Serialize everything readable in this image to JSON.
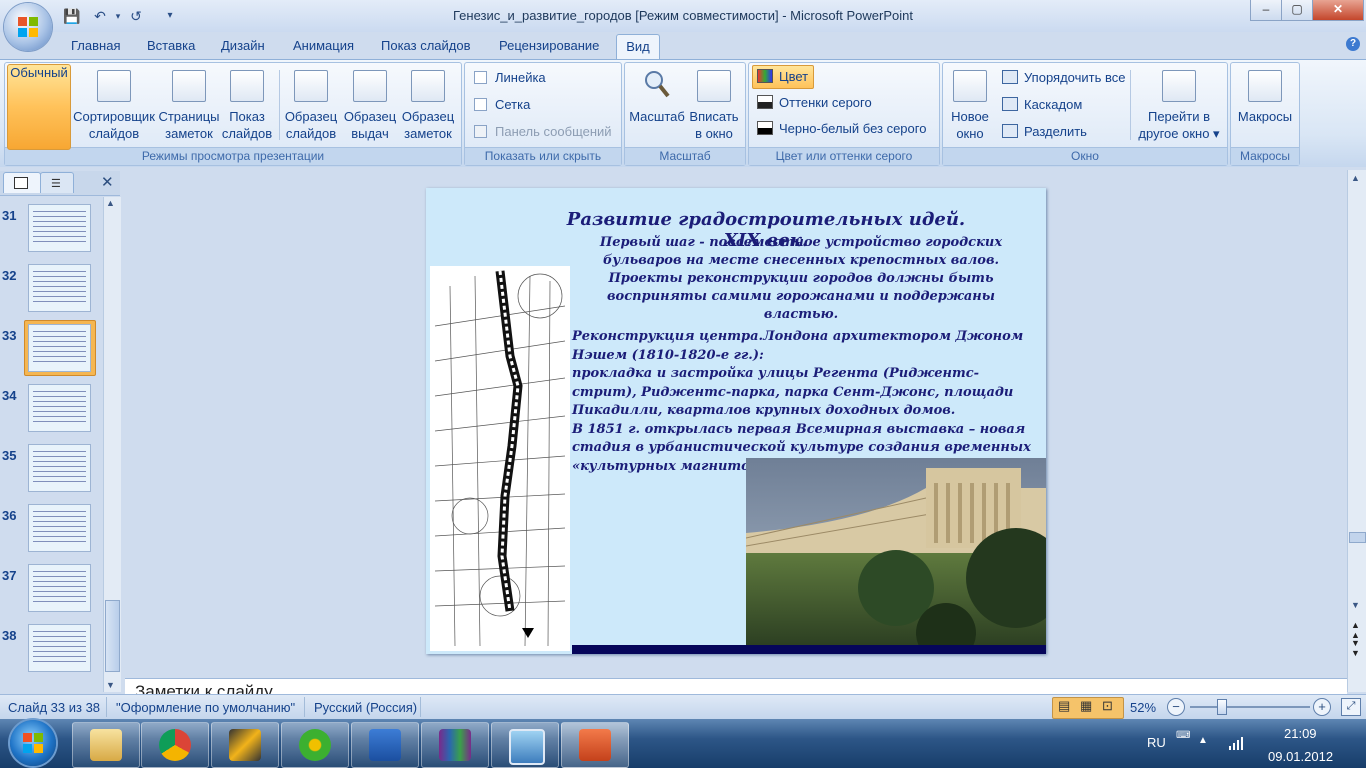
{
  "window": {
    "title": "Генезис_и_развитие_городов [Режим совместимости] - Microsoft PowerPoint",
    "min": "–",
    "max": "▢",
    "close": "✕"
  },
  "quick_access": {
    "save": "💾",
    "undo": "↶",
    "undo_arrow": "▾",
    "redo": "↺",
    "customize": "▾"
  },
  "tabs": [
    "Главная",
    "Вставка",
    "Дизайн",
    "Анимация",
    "Показ слайдов",
    "Рецензирование",
    "Вид"
  ],
  "active_tab": "Вид",
  "ribbon": {
    "views": {
      "label": "Режимы просмотра презентации",
      "normal": "Обычный",
      "sorter": [
        "Сортировщик",
        "слайдов"
      ],
      "notes": [
        "Страницы",
        "заметок"
      ],
      "show": [
        "Показ",
        "слайдов"
      ],
      "master_slide": [
        "Образец",
        "слайдов"
      ],
      "master_handout": [
        "Образец",
        "выдач"
      ],
      "master_notes": [
        "Образец",
        "заметок"
      ]
    },
    "show_hide": {
      "label": "Показать или скрыть",
      "ruler": "Линейка",
      "grid": "Сетка",
      "message_bar": "Панель сообщений"
    },
    "zoom": {
      "label": "Масштаб",
      "zoom": "Масштаб",
      "fit": [
        "Вписать",
        "в окно"
      ]
    },
    "color": {
      "label": "Цвет или оттенки серого",
      "color": "Цвет",
      "grayscale": "Оттенки серого",
      "bw": "Черно-белый без серого"
    },
    "window": {
      "label": "Окно",
      "new": [
        "Новое",
        "окно"
      ],
      "arrange": "Упорядочить все",
      "cascade": "Каскадом",
      "split": "Разделить",
      "switch": [
        "Перейти в",
        "другое окно ▾"
      ]
    },
    "macros": {
      "label": "Макросы",
      "macros": "Макросы"
    }
  },
  "slides_panel": {
    "close": "✕",
    "thumbnails": [
      "31",
      "32",
      "33",
      "34",
      "35",
      "36",
      "37",
      "38"
    ],
    "selected": "33"
  },
  "slide": {
    "title": "Развитие градостроительных идей. XIX век.",
    "subtitle_1": "Первый шаг - повсеместное устройство городских бульваров на месте снесенных крепостных валов.",
    "subtitle_2": "Проекты реконструкции городов должны быть восприняты самими горожанами и поддержаны властью.",
    "body_1": "Реконструкция центра.Лондона архитектором Джоном Нэшем (1810-1820-е гг.):",
    "body_2": "прокладка и застройка улицы Регента (Риджентс-стрит), Риджентс-парка, парка Сент-Джонс, площади Пикадилли, кварталов крупных доходных домов.",
    "body_3": "В 1851 г. открылась первая Всемирная выставка – новая стадия в урбанистической культуре создания временных «культурных магнитов»."
  },
  "notes_placeholder": "Заметки к слайду",
  "status": {
    "slide": "Слайд 33 из 38",
    "theme": "\"Оформление по умолчанию\"",
    "language": "Русский (Россия)",
    "zoom": "52%",
    "zoom_out": "−",
    "zoom_in": "+",
    "zoom_fraction": 0.52
  },
  "taskbar": {
    "lang": "RU",
    "time": "21:09",
    "date": "09.01.2012"
  }
}
